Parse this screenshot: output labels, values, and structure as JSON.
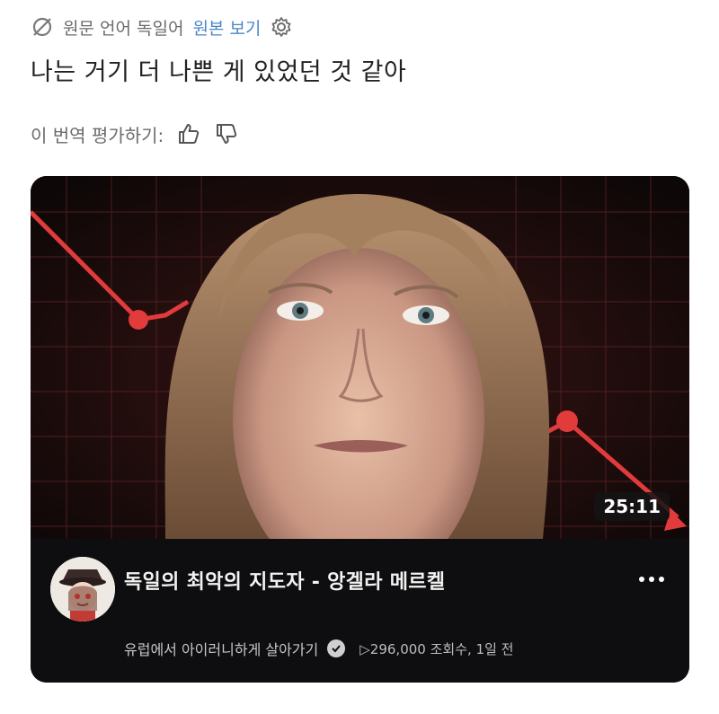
{
  "translate_bar": {
    "source_language": "원문 언어 독일어",
    "view_original": "원본 보기",
    "icon": "no-translate-icon",
    "settings_icon": "gear-icon"
  },
  "translated_text": "나는 거기 더 나쁜 게 있었던 것 같아",
  "rating": {
    "label": "이 번역 평가하기:",
    "thumbs_up_icon": "thumbs-up-icon",
    "thumbs_down_icon": "thumbs-down-icon"
  },
  "video": {
    "duration": "25:11",
    "title": "독일의 최악의 지도자 - 앙겔라 메르켈",
    "channel": "유럽에서 아이러니하게 살아가기",
    "stats": "▷296,000 조회수, 1일 전",
    "colors": {
      "chart_line": "#e23b3b",
      "grid": "#6a2a2a",
      "card_bg": "#0e0e10"
    }
  }
}
